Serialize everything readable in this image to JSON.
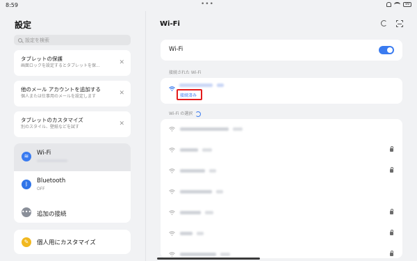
{
  "status_bar": {
    "time": "8:59",
    "battery": "99"
  },
  "left": {
    "title": "設定",
    "search_placeholder": "設定を検索",
    "cards": [
      {
        "title": "タブレットの保護",
        "subtitle": "画面ロックを設定するとタブレットを保..."
      },
      {
        "title": "他のメール アカウントを追加する",
        "subtitle": "個人または仕事用のメールを設定します"
      },
      {
        "title": "タブレットのカスタマイズ",
        "subtitle": "別のスタイル、壁紙などを試す"
      }
    ],
    "menu": {
      "wifi": {
        "label": "Wi-Fi"
      },
      "bluetooth": {
        "label": "Bluetooth",
        "sub": "OFF"
      },
      "more": {
        "label": "追加の接続"
      }
    },
    "personalize": {
      "label": "個人用にカスタマイズ"
    }
  },
  "right": {
    "title": "Wi-Fi",
    "toggle_label": "Wi-Fi",
    "toggle_on": true,
    "connected_header": "接続された Wi-Fi",
    "connected_status": "接続済み",
    "select_header": "Wi-Fi の選択"
  },
  "colors": {
    "accent": "#3a7bf0",
    "highlight": "#e41c1c",
    "bg": "#f1f2f4"
  }
}
